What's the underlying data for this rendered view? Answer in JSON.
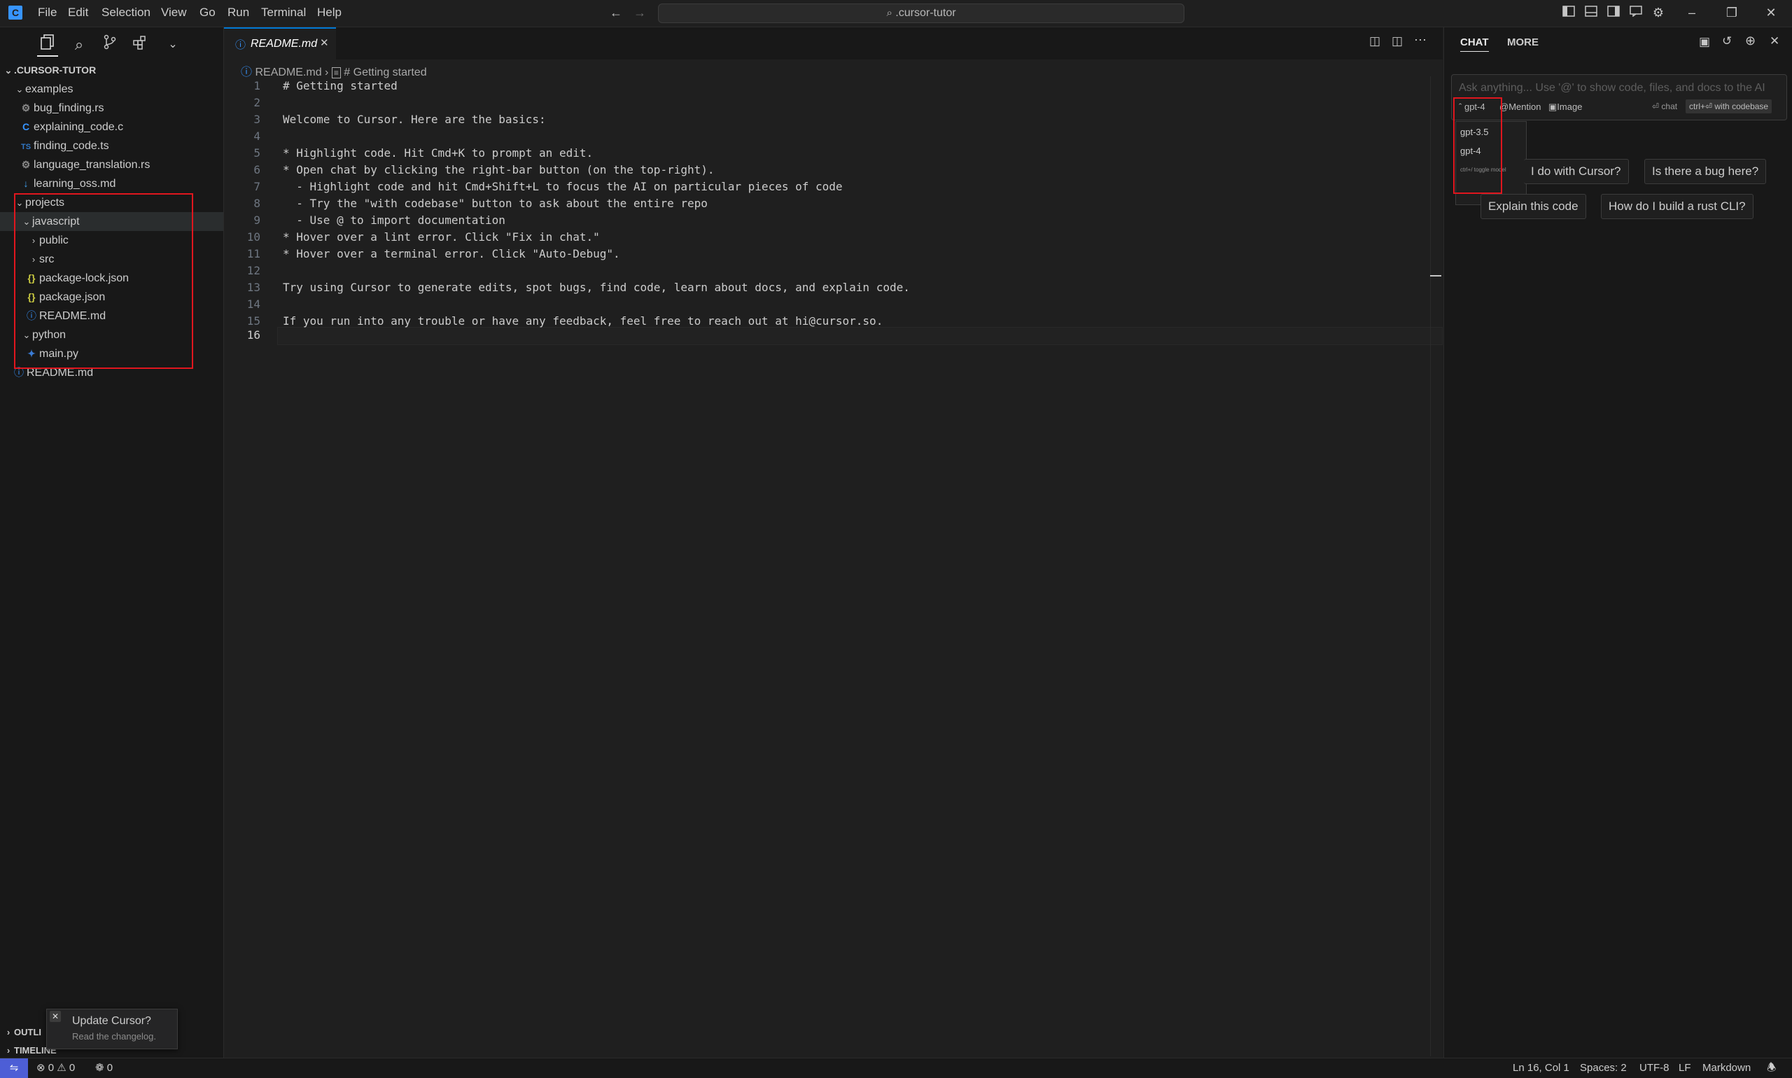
{
  "titlebar": {
    "menu": [
      "File",
      "Edit",
      "Selection",
      "View",
      "Go",
      "Run",
      "Terminal",
      "Help"
    ],
    "search_text": ".cursor-tutor",
    "nav_back": "←",
    "nav_forward": "→"
  },
  "explorer": {
    "root": ".CURSOR-TUTOR",
    "items": [
      {
        "label": "examples",
        "kind": "folder-open"
      },
      {
        "label": "bug_finding.rs",
        "kind": "rust"
      },
      {
        "label": "explaining_code.c",
        "kind": "c"
      },
      {
        "label": "finding_code.ts",
        "kind": "ts"
      },
      {
        "label": "language_translation.rs",
        "kind": "rust"
      },
      {
        "label": "learning_oss.md",
        "kind": "md"
      },
      {
        "label": "projects",
        "kind": "folder-open"
      },
      {
        "label": "javascript",
        "kind": "folder-open"
      },
      {
        "label": "public",
        "kind": "folder"
      },
      {
        "label": "src",
        "kind": "folder"
      },
      {
        "label": "package-lock.json",
        "kind": "json"
      },
      {
        "label": "package.json",
        "kind": "json"
      },
      {
        "label": "README.md",
        "kind": "info"
      },
      {
        "label": "python",
        "kind": "folder-open"
      },
      {
        "label": "main.py",
        "kind": "py"
      },
      {
        "label": "README.md",
        "kind": "info"
      }
    ],
    "outline_label": "OUTLI",
    "timeline_label": "TIMELINE"
  },
  "editor": {
    "tab_label": "README.md",
    "breadcrumb": [
      "README.md",
      "# Getting started"
    ],
    "lines": [
      "# Getting started",
      "",
      "Welcome to Cursor. Here are the basics:",
      "",
      "* Highlight code. Hit Cmd+K to prompt an edit.",
      "* Open chat by clicking the right-bar button (on the top-right).",
      "  - Highlight code and hit Cmd+Shift+L to focus the AI on particular pieces of code",
      "  - Try the \"with codebase\" button to ask about the entire repo",
      "  - Use @ to import documentation",
      "* Hover over a lint error. Click \"Fix in chat.\"",
      "* Hover over a terminal error. Click \"Auto-Debug\".",
      "",
      "Try using Cursor to generate edits, spot bugs, find code, learn about docs, and explain code.",
      "",
      "If you run into any trouble or have any feedback, feel free to reach out at hi@cursor.so.",
      ""
    ],
    "line_numbers": [
      "1",
      "2",
      "3",
      "4",
      "5",
      "6",
      "7",
      "8",
      "9",
      "10",
      "11",
      "12",
      "13",
      "14",
      "15",
      "16"
    ]
  },
  "chat": {
    "tabs": [
      "CHAT",
      "MORE"
    ],
    "input_placeholder": "Ask anything... Use '@' to show code, files, and docs to the AI",
    "model_selected": "gpt-4",
    "mention_label": "Mention",
    "image_label": "Image",
    "chat_hint": "⏎ chat",
    "codebase_hint": "ctrl+⏎ with codebase",
    "model_options": [
      "gpt-3.5",
      "gpt-4"
    ],
    "toggle_hint": "ctrl+/ toggle model",
    "suggestions": [
      "I do with Cursor?",
      "Is there a bug here?",
      "Explain this code",
      "How do I build a rust CLI?"
    ]
  },
  "notification": {
    "title": "Update Cursor?",
    "subtitle": "Read the changelog."
  },
  "statusbar": {
    "errors": "0",
    "warnings": "0",
    "ports": "0",
    "position": "Ln 16, Col 1",
    "spaces": "Spaces: 2",
    "encoding": "UTF-8",
    "eol": "LF",
    "language": "Markdown"
  },
  "colors": {
    "accent": "#0078d4",
    "highlight_box": "#e0161e",
    "remote_indicator": "#4d5ed6"
  }
}
